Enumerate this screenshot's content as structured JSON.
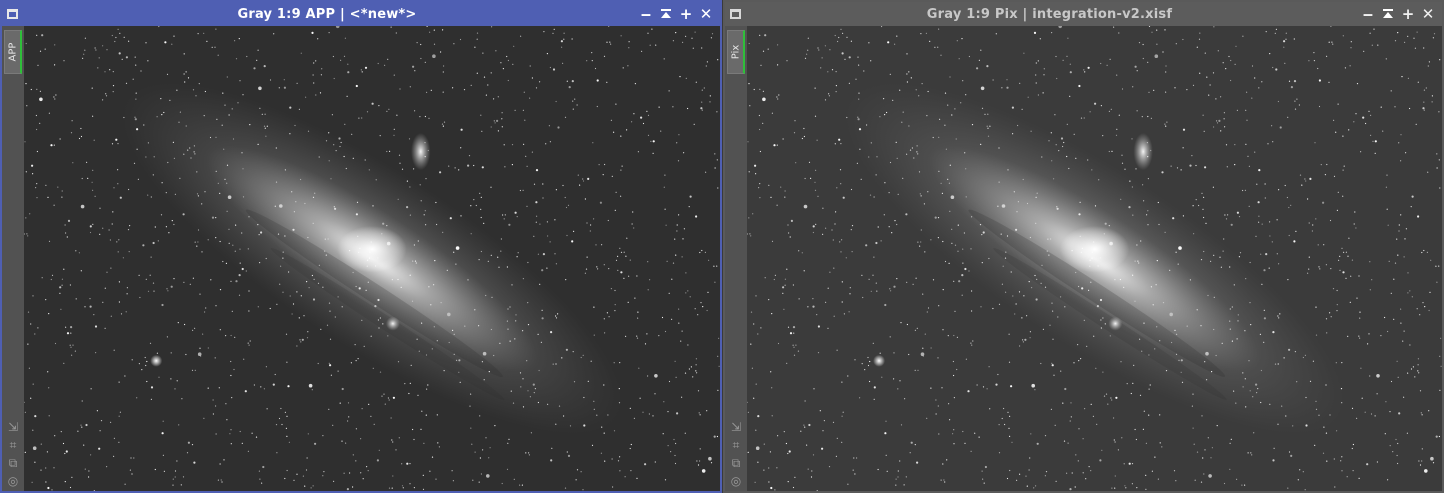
{
  "windows": [
    {
      "id": "left",
      "title": "Gray 1:9 APP | <*new*>",
      "side_tab": "APP",
      "active": true
    },
    {
      "id": "right",
      "title": "Gray 1:9 Pix | integration-v2.xisf",
      "side_tab": "Pix",
      "active": false
    }
  ],
  "controls": {
    "minimize": "‒",
    "shade": "⏶",
    "maximize": "+",
    "close": "✕"
  },
  "sidebar_tools": [
    "fit-view-icon",
    "zoom-to-fit-icon",
    "duplicate-icon",
    "target-icon"
  ],
  "colors": {
    "active_frame": "#4f5fb3",
    "inactive_frame": "#5c5c5c",
    "tab_accent": "#2fbf3a"
  }
}
